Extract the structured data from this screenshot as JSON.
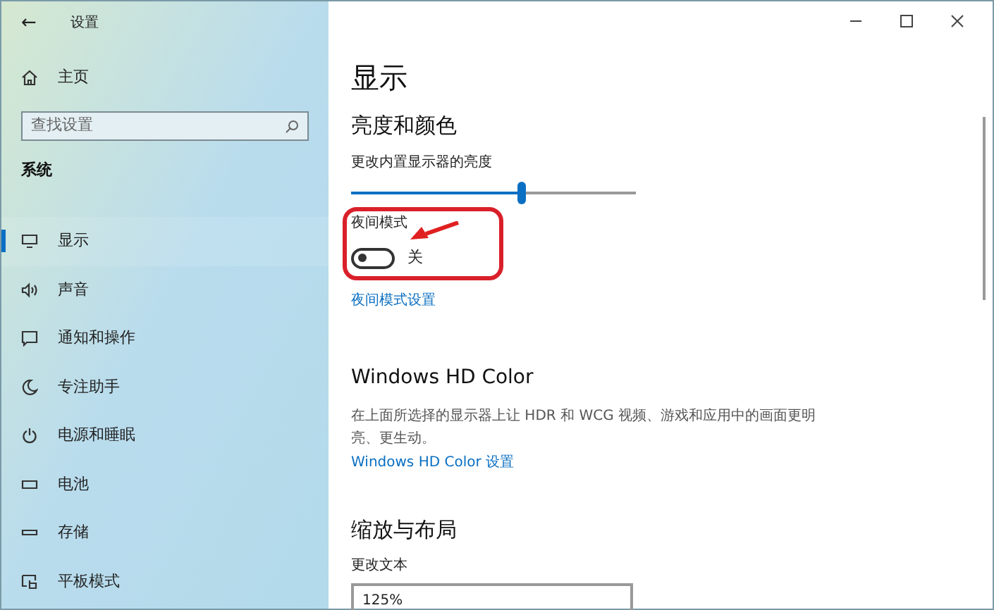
{
  "window": {
    "title": "设置",
    "back": "←"
  },
  "sidebar": {
    "home": "主页",
    "search": {
      "placeholder": "查找设置"
    },
    "section": "系统",
    "items": [
      {
        "label": "显示",
        "selected": true
      },
      {
        "label": "声音",
        "selected": false
      },
      {
        "label": "通知和操作",
        "selected": false
      },
      {
        "label": "专注助手",
        "selected": false
      },
      {
        "label": "电源和睡眠",
        "selected": false
      },
      {
        "label": "电池",
        "selected": false
      },
      {
        "label": "存储",
        "selected": false
      },
      {
        "label": "平板模式",
        "selected": false
      }
    ]
  },
  "content": {
    "title": "显示",
    "brightness": {
      "heading": "亮度和颜色",
      "label": "更改内置显示器的亮度",
      "level": 0.6
    },
    "night_light": {
      "label": "夜间模式",
      "on": false,
      "state_text": "关",
      "link": "夜间模式设置"
    },
    "hd_color": {
      "heading": "Windows HD Color",
      "description": "在上面所选择的显示器上让 HDR 和 WCG 视频、游戏和应用中的画面更明亮、更生动。",
      "link": "Windows HD Color 设置"
    },
    "scale": {
      "heading": "缩放与布局",
      "label": "更改文本",
      "dropdown": "125%"
    }
  }
}
